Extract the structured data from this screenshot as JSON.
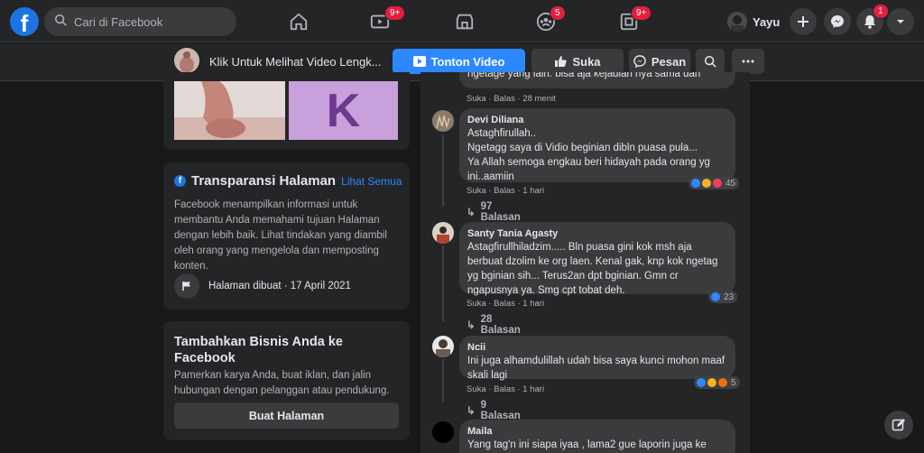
{
  "colors": {
    "accent": "#2d88ff",
    "badge": "#e41e3f",
    "bg": "#18191a",
    "card": "#242526",
    "bubble": "#3a3b3c"
  },
  "topbar": {
    "logo": "f",
    "search_placeholder": "Cari di Facebook",
    "icons": [
      "home-icon",
      "watch-icon",
      "marketplace-icon",
      "groups-icon",
      "gaming-icon"
    ],
    "badges": {
      "watch": "9+",
      "groups": "5",
      "gaming": "9+",
      "notifications": "1"
    },
    "user_name": "Yayu"
  },
  "subbar": {
    "page_title": "Klik Untuk Melihat Video Lengk...",
    "watch_button": "Tonton Video",
    "like_button": "Suka",
    "message_button": "Pesan"
  },
  "left": {
    "photo_letter": "K",
    "transparency": {
      "title": "Transparansi Halaman",
      "see_all": "Lihat Semua",
      "body": "Facebook menampilkan informasi untuk membantu Anda memahami tujuan Halaman dengan lebih baik. Lihat tindakan yang diambil oleh orang yang mengelola dan memposting konten.",
      "created": "Halaman dibuat · 17 April 2021"
    },
    "business": {
      "title": "Tambahkan Bisnis Anda ke Facebook",
      "body": "Pamerkan karya Anda, buat iklan, dan jalin hubungan dengan pelanggan atau pendukung.",
      "button": "Buat Halaman"
    }
  },
  "comments": {
    "top_partial": {
      "text": "ngetage yang lain. bisa aja kejadian nya sama dan",
      "actions": "Suka · Balas · 28 menit"
    },
    "items": [
      {
        "name": "Devi Diliana",
        "text": "Astaghfirullah..\nNgetagg saya di Vidio beginian dibln puasa pula...\nYa Allah semoga engkau beri hidayah pada orang yg ini..aamiin",
        "actions": "Suka · Balas · 1 hari",
        "reactions": "45",
        "replies": "97 Balasan"
      },
      {
        "name": "Santy Tania Agasty",
        "text": "Astagfirullhiladzim..... Bln puasa gini kok msh aja berbuat dzolim ke org laen. Kenal gak, knp kok ngetag yg bginian sih... Terus2an dpt bginian. Gmn cr ngapusnya ya. Smg cpt tobat deh.",
        "actions": "Suka · Balas · 1 hari",
        "reactions": "23",
        "replies": "28 Balasan"
      },
      {
        "name": "Ncii",
        "text": "Ini juga alhamdulillah udah bisa saya kunci mohon maaf skali lagi",
        "actions": "Suka · Balas · 1 hari",
        "reactions": "5",
        "replies": "9 Balasan"
      },
      {
        "name": "Maila",
        "text": "Yang tag'n ini siapa iyaa , lama2 gue laporin juga ke"
      }
    ]
  }
}
